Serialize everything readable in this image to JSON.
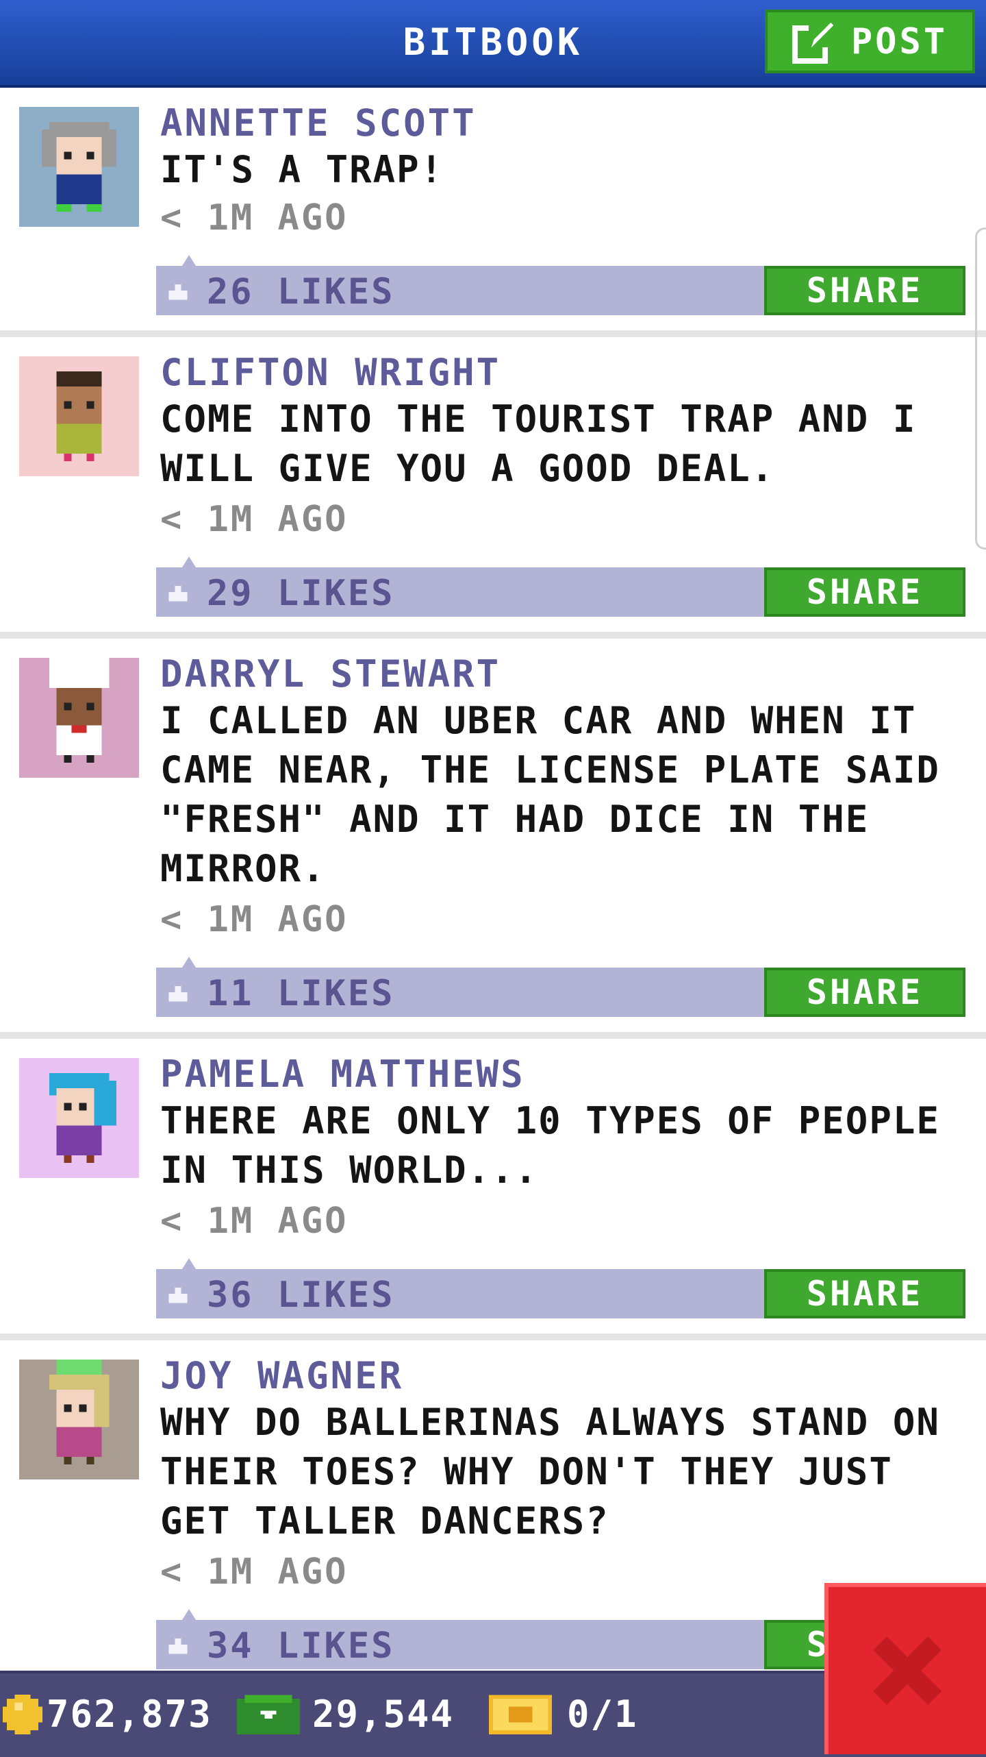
{
  "header": {
    "title": "BITBOOK",
    "post_label": "POST"
  },
  "posts": [
    {
      "name": "ANNETTE SCOTT",
      "text": "IT'S A TRAP!",
      "time": "< 1M AGO",
      "likes": "26 LIKES",
      "share": "SHARE",
      "avatar_bg": "#8eaec7"
    },
    {
      "name": "CLIFTON WRIGHT",
      "text": "COME INTO THE TOURIST TRAP AND I WILL GIVE YOU A GOOD DEAL.",
      "time": "< 1M AGO",
      "likes": "29 LIKES",
      "share": "SHARE",
      "avatar_bg": "#f5cdcf"
    },
    {
      "name": "DARRYL STEWART",
      "text": "I CALLED AN UBER CAR AND WHEN IT CAME NEAR, THE LICENSE PLATE SAID \"FRESH\" AND IT HAD DICE IN THE MIRROR.",
      "time": "< 1M AGO",
      "likes": "11 LIKES",
      "share": "SHARE",
      "avatar_bg": "#d7a3c2"
    },
    {
      "name": "PAMELA MATTHEWS",
      "text": "THERE ARE ONLY 10 TYPES OF PEOPLE IN THIS WORLD...",
      "time": "< 1M AGO",
      "likes": "36 LIKES",
      "share": "SHARE",
      "avatar_bg": "#e9c1f2"
    },
    {
      "name": "JOY WAGNER",
      "text": "WHY DO BALLERINAS ALWAYS STAND ON THEIR TOES? WHY DON'T THEY JUST GET TALLER DANCERS?",
      "time": "< 1M AGO",
      "likes": "34 LIKES",
      "share": "SHARE",
      "avatar_bg": "#a99d92"
    }
  ],
  "footer": {
    "coins": "762,873",
    "bux": "29,544",
    "tickets": "0/1"
  },
  "colors": {
    "header": "#2a55c0",
    "share_green": "#3fa82e",
    "likes_bar": "#b3b3d6",
    "name_purple": "#5e5b9a",
    "close_red": "#e3262e"
  }
}
